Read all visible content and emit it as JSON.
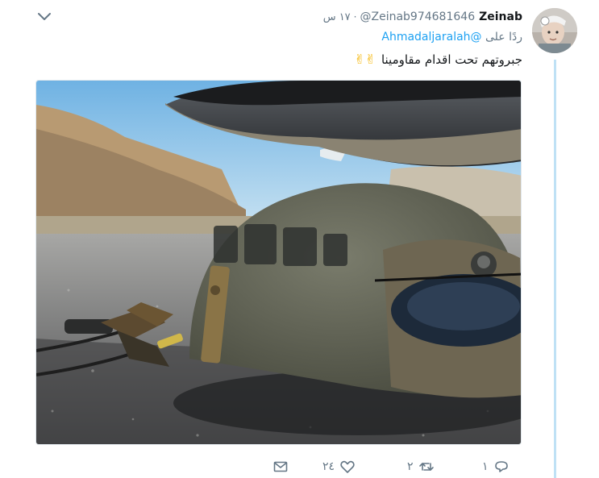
{
  "tweet": {
    "author_name": "Zeinab",
    "handle": "@Zeinab974681646",
    "separator": "·",
    "time": "١٧ س",
    "reply_prefix": "ردًا على",
    "reply_to": "@Ahmadaljaralah",
    "text": "جبروتهم تحت اقدام مقاومينا",
    "emoji": "✌✌"
  },
  "actions": {
    "reply_count": "١",
    "retweet_count": "٢",
    "like_count": "٢٤"
  },
  "icons": {
    "caret": "chevron-down-icon",
    "reply": "reply-icon",
    "retweet": "retweet-icon",
    "like": "heart-icon",
    "message": "envelope-icon"
  },
  "colors": {
    "link": "#1da1f2",
    "muted": "#657786",
    "text": "#14171a",
    "thread_line": "#bfe1f5"
  }
}
